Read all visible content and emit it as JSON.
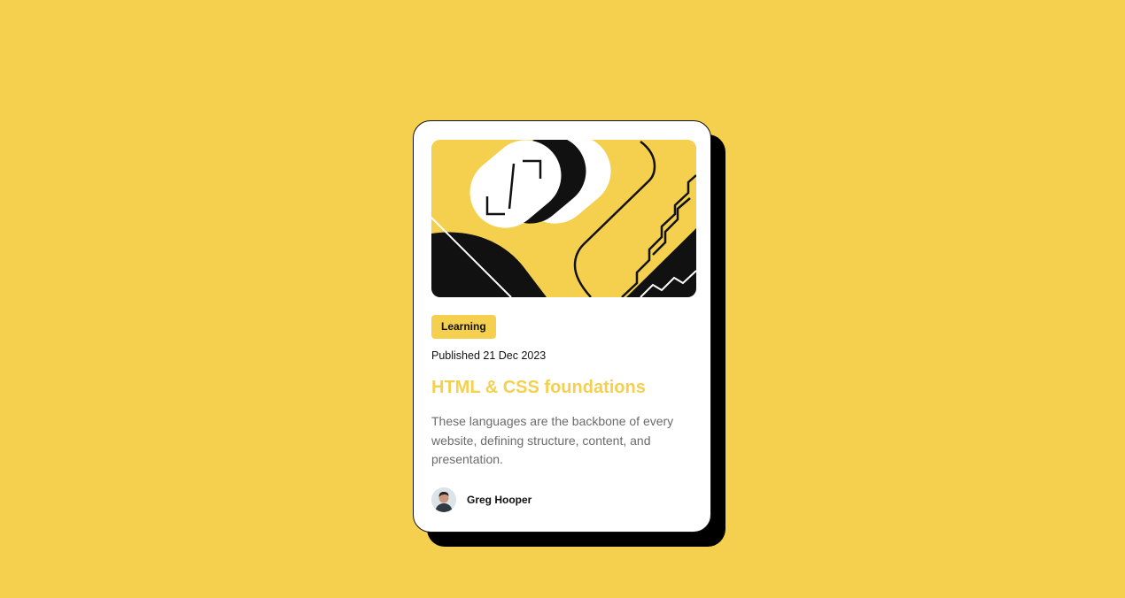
{
  "card": {
    "tag": "Learning",
    "published": "Published 21 Dec 2023",
    "title": "HTML & CSS foundations",
    "description": "These languages are the backbone of every website, defining structure, content, and presentation.",
    "author": {
      "name": "Greg Hooper",
      "avatar_icon": "person-avatar-icon"
    },
    "hero_illustration": "abstract-illustration-icon"
  },
  "colors": {
    "background": "#F4D04E",
    "card": "#FFFFFF",
    "shadow": "#000000",
    "accent": "#F4D04E",
    "text": "#111111",
    "muted": "#6B6B6B"
  }
}
